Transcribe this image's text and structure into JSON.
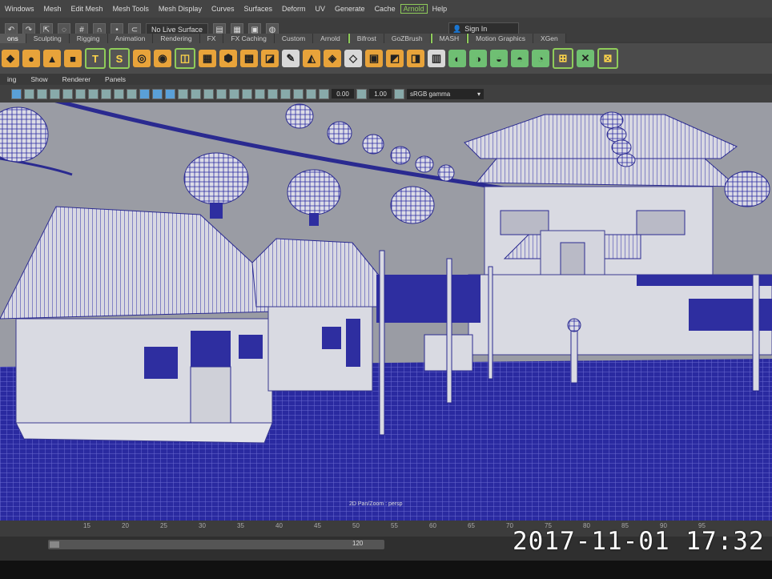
{
  "menubar": {
    "items": [
      "Windows",
      "Mesh",
      "Edit Mesh",
      "Mesh Tools",
      "Mesh Display",
      "Curves",
      "Surfaces",
      "Deform",
      "UV",
      "Generate",
      "Cache",
      "Arnold",
      "Help"
    ]
  },
  "status": {
    "live_surface": "No Live Surface",
    "sign_in": "Sign In"
  },
  "shelf_tabs": [
    "ons",
    "Sculpting",
    "Rigging",
    "Animation",
    "Rendering",
    "FX",
    "FX Caching",
    "Custom",
    "Arnold",
    "Bifrost",
    "GoZBrush",
    "MASH",
    "Motion Graphics",
    "XGen"
  ],
  "shelf_icons": [
    "poly-cube-icon",
    "poly-sphere-icon",
    "poly-cone-icon",
    "type-tool-icon",
    "svg-tool-icon"
  ],
  "panel_menu": [
    "ing",
    "Show",
    "Renderer",
    "Panels"
  ],
  "panel_toolbar": {
    "exposure": "0.00",
    "gamma": "1.00",
    "color_space": "sRGB gamma"
  },
  "viewport": {
    "camera_label": "2D Pan/Zoom : persp"
  },
  "timeline": {
    "ticks": [
      "15",
      "20",
      "25",
      "30",
      "35",
      "40",
      "45",
      "50",
      "55",
      "60",
      "65",
      "70",
      "75",
      "80",
      "85",
      "90",
      "95"
    ],
    "range_end": "120"
  },
  "photo_timestamp": "2017-11-01 17:32"
}
